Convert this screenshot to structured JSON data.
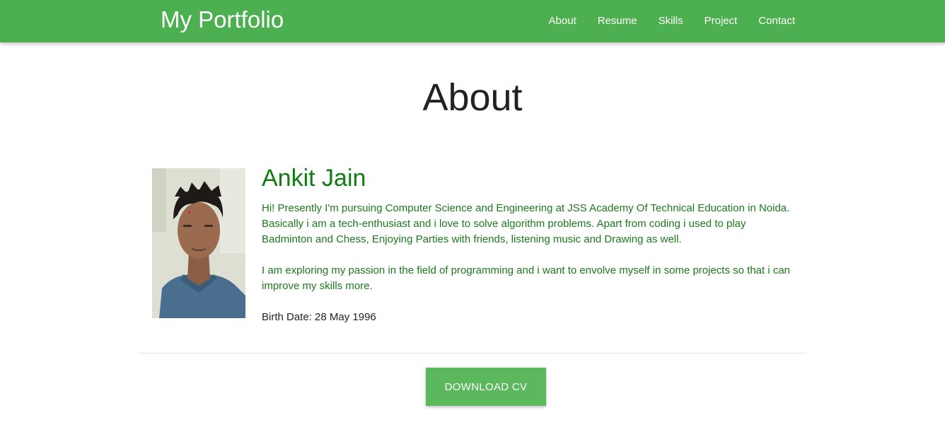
{
  "navbar": {
    "brand": "My Portfolio",
    "links": [
      {
        "label": "About"
      },
      {
        "label": "Resume"
      },
      {
        "label": "Skills"
      },
      {
        "label": "Project"
      },
      {
        "label": "Contact"
      }
    ],
    "background_color": "#4caf50"
  },
  "about": {
    "heading": "About",
    "name": "Ankit Jain",
    "paragraphs": [
      "Hi! Presently I'm pursuing Computer Science and Engineering at JSS Academy Of Technical Education in Noida. Basically i am a tech-enthusiast and i love to solve algorithm problems. Apart from coding i used to play Badminton and Chess, Enjoying Parties with friends, listening music and Drawing as well.",
      "I am exploring my passion in the field of programming and i want to envolve myself in some projects so that i can improve my skills more."
    ],
    "birth_date": "Birth Date: 28 May 1996",
    "name_color": "#0f7d0f",
    "text_color": "#1b7a1b"
  },
  "actions": {
    "download_label": "DOWNLOAD CV",
    "button_color": "#5cb85c"
  }
}
